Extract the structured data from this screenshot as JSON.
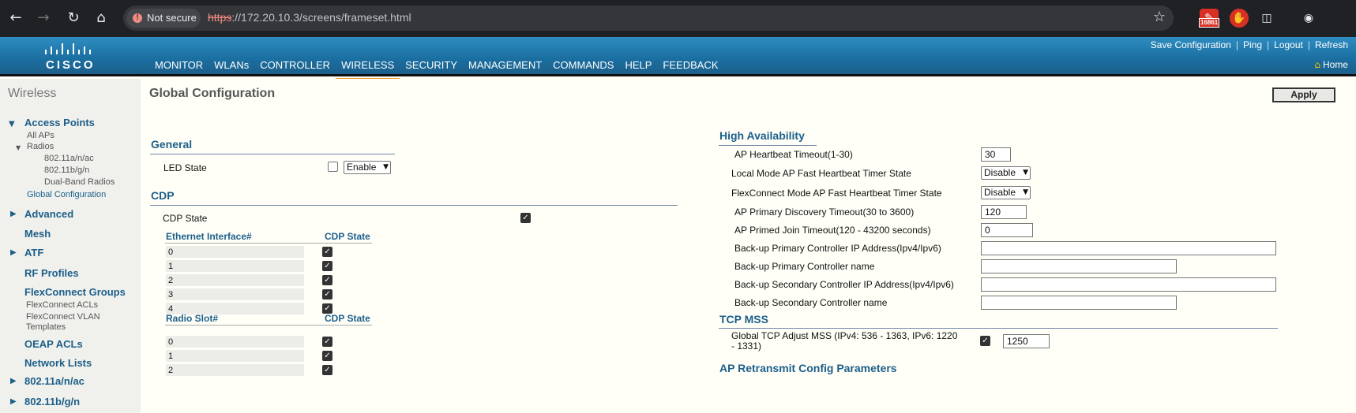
{
  "browser": {
    "not_secure": "Not secure",
    "url_scheme": "https",
    "url_rest": "://172.20.10.3/screens/frameset.html",
    "ext_badge": "16861"
  },
  "header": {
    "logo_text": "CISCO",
    "nav": [
      "MONITOR",
      "WLANs",
      "CONTROLLER",
      "WIRELESS",
      "SECURITY",
      "MANAGEMENT",
      "COMMANDS",
      "HELP",
      "FEEDBACK"
    ],
    "active_nav": "WIRELESS",
    "links": [
      "Save Configuration",
      "Ping",
      "Logout",
      "Refresh"
    ],
    "home": "Home"
  },
  "sidebar": {
    "title": "Wireless",
    "sections": [
      "Access Points",
      "Advanced",
      "Mesh",
      "ATF",
      "RF Profiles",
      "FlexConnect Groups",
      "OEAP ACLs",
      "Network Lists",
      "802.11a/n/ac",
      "802.11b/g/n"
    ],
    "ap_items": [
      "All APs",
      "Radios",
      "802.11a/n/ac",
      "802.11b/g/n",
      "Dual-Band Radios",
      "Global Configuration"
    ],
    "flex_items": [
      "FlexConnect ACLs",
      "FlexConnect VLAN",
      "Templates"
    ]
  },
  "main": {
    "title": "Global Configuration",
    "apply": "Apply",
    "general": {
      "heading": "General",
      "led_label": "LED State",
      "led_value": "Enable"
    },
    "cdp": {
      "heading": "CDP",
      "state_label": "CDP State",
      "eth_header": "Ethernet Interface#",
      "cdp_header": "CDP State",
      "eth_rows": [
        "0",
        "1",
        "2",
        "3",
        "4"
      ],
      "radio_header": "Radio Slot#",
      "radio_cdp_header": "CDP State",
      "radio_rows": [
        "0",
        "1",
        "2"
      ]
    },
    "ha": {
      "heading": "High Availability",
      "rows": [
        {
          "label": "AP Heartbeat Timeout(1-30)",
          "value": "30"
        },
        {
          "label": "Local Mode AP Fast Heartbeat Timer State",
          "value": "Disable"
        },
        {
          "label": "FlexConnect Mode AP Fast Heartbeat Timer State",
          "value": "Disable"
        },
        {
          "label": "AP Primary Discovery Timeout(30 to 3600)",
          "value": "120"
        },
        {
          "label": "AP Primed Join Timeout(120 - 43200 seconds)",
          "value": "0"
        },
        {
          "label": "Back-up Primary Controller IP Address(Ipv4/Ipv6)",
          "value": ""
        },
        {
          "label": "Back-up Primary Controller name",
          "value": ""
        },
        {
          "label": "Back-up Secondary Controller IP Address(Ipv4/Ipv6)",
          "value": ""
        },
        {
          "label": "Back-up Secondary Controller name",
          "value": ""
        }
      ]
    },
    "tcp": {
      "heading": "TCP MSS",
      "label_line1": "Global TCP Adjust MSS (IPv4: 536 - 1363, IPv6: 1220",
      "label_line2": "- 1331)",
      "value": "1250"
    },
    "retransmit_heading": "AP Retransmit Config Parameters"
  }
}
